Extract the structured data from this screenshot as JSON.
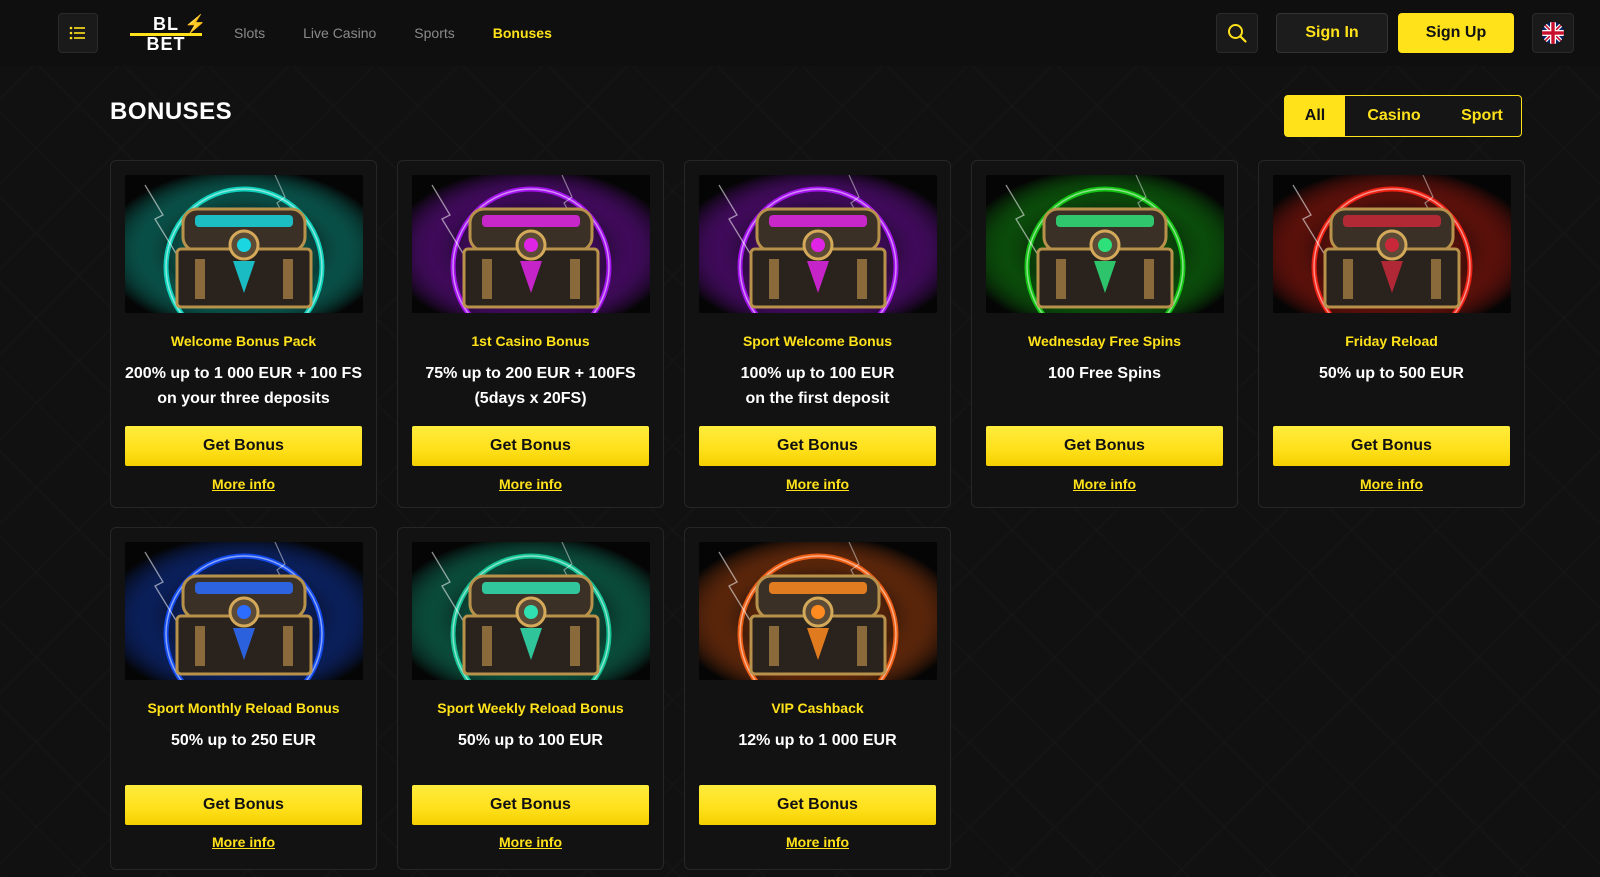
{
  "header": {
    "logo_text": "BLITZ BET",
    "nav": [
      "Slots",
      "Live Casino",
      "Sports",
      "Bonuses"
    ],
    "active_nav": "Bonuses",
    "sign_in": "Sign In",
    "sign_up": "Sign Up",
    "language": "uk-flag-icon"
  },
  "page": {
    "title": "BONUSES",
    "filters": [
      "All",
      "Casino",
      "Sport"
    ],
    "active_filter": "All"
  },
  "colors": {
    "accent": "#ffe21a",
    "background": "#0d0d0d",
    "card": "#121212"
  },
  "bonuses": [
    {
      "title": "Welcome Bonus Pack",
      "line1": "200% up to 1 000 EUR + 100 FS",
      "line2": "on your three deposits",
      "button": "Get Bonus",
      "link": "More info",
      "glow": "#10e0c8",
      "chest_accent": "#19d6e0"
    },
    {
      "title": "1st Casino Bonus",
      "line1": "75% up to 200 EUR + 100FS",
      "line2": "(5days x 20FS)",
      "button": "Get Bonus",
      "link": "More info",
      "glow": "#b014ff",
      "chest_accent": "#e024e6"
    },
    {
      "title": "Sport Welcome Bonus",
      "line1": "100% up to 100 EUR",
      "line2": "on the first deposit",
      "button": "Get Bonus",
      "link": "More info",
      "glow": "#b014ff",
      "chest_accent": "#e024e6"
    },
    {
      "title": "Wednesday Free Spins",
      "line1": "100 Free Spins",
      "line2": "",
      "button": "Get Bonus",
      "link": "More info",
      "glow": "#14d214",
      "chest_accent": "#2ee07a"
    },
    {
      "title": "Friday Reload",
      "line1": "50% up to 500 EUR",
      "line2": "",
      "button": "Get Bonus",
      "link": "More info",
      "glow": "#ff2414",
      "chest_accent": "#c8283a"
    },
    {
      "title": "Sport Monthly Reload Bonus",
      "line1": "50% up to 250 EUR",
      "line2": "",
      "button": "Get Bonus",
      "link": "More info",
      "glow": "#1450ff",
      "chest_accent": "#2c6cff"
    },
    {
      "title": "Sport Weekly Reload Bonus",
      "line1": "50% up to 100 EUR",
      "line2": "",
      "button": "Get Bonus",
      "link": "More info",
      "glow": "#14d2a0",
      "chest_accent": "#30e0b0"
    },
    {
      "title": "VIP Cashback",
      "line1": "12% up to 1 000 EUR",
      "line2": "",
      "button": "Get Bonus",
      "link": "More info",
      "glow": "#ff6414",
      "chest_accent": "#ff8a20"
    }
  ]
}
